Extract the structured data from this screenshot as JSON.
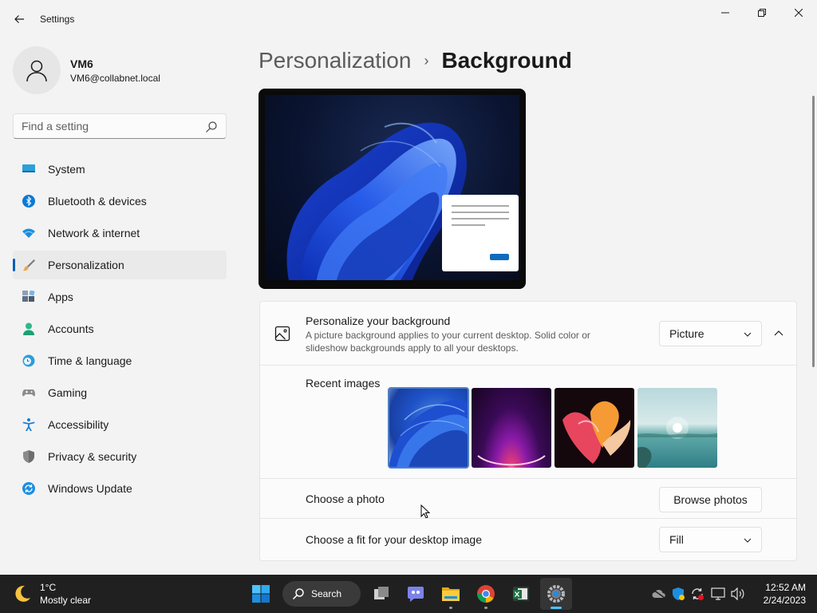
{
  "window": {
    "title": "Settings"
  },
  "profile": {
    "name": "VM6",
    "email": "VM6@collabnet.local"
  },
  "search": {
    "placeholder": "Find a setting"
  },
  "nav": {
    "items": [
      {
        "label": "System",
        "icon": "system-icon"
      },
      {
        "label": "Bluetooth & devices",
        "icon": "bluetooth-icon"
      },
      {
        "label": "Network & internet",
        "icon": "wifi-icon"
      },
      {
        "label": "Personalization",
        "icon": "brush-icon",
        "active": true
      },
      {
        "label": "Apps",
        "icon": "apps-icon"
      },
      {
        "label": "Accounts",
        "icon": "accounts-icon"
      },
      {
        "label": "Time & language",
        "icon": "clock-globe-icon"
      },
      {
        "label": "Gaming",
        "icon": "gamepad-icon"
      },
      {
        "label": "Accessibility",
        "icon": "accessibility-icon"
      },
      {
        "label": "Privacy & security",
        "icon": "shield-icon"
      },
      {
        "label": "Windows Update",
        "icon": "update-icon"
      }
    ]
  },
  "breadcrumb": {
    "parent": "Personalization",
    "separator": "›",
    "current": "Background"
  },
  "background": {
    "title": "Personalize your background",
    "description": "A picture background applies to your current desktop. Solid color or slideshow backgrounds apply to all your desktops.",
    "type_value": "Picture",
    "recent_label": "Recent images",
    "recent_images": [
      {
        "name": "Windows 11 bloom blue",
        "selected": true
      },
      {
        "name": "Purple glow"
      },
      {
        "name": "Colorful ribbon"
      },
      {
        "name": "Lake at sunrise"
      }
    ],
    "choose_photo_label": "Choose a photo",
    "browse_label": "Browse photos",
    "fit_label": "Choose a fit for your desktop image",
    "fit_value": "Fill"
  },
  "taskbar": {
    "weather_temp": "1°C",
    "weather_condition": "Mostly clear",
    "search_label": "Search",
    "apps": [
      "start-icon",
      "search",
      "task-view-icon",
      "teams-chat-icon",
      "file-explorer-icon",
      "chrome-icon",
      "excel-icon",
      "settings-icon"
    ],
    "tray": [
      "onedrive-icon",
      "security-icon",
      "sync-icon",
      "display-icon",
      "volume-icon"
    ],
    "time": "12:52 AM",
    "date": "2/24/2023"
  },
  "colors": {
    "accent": "#005fb8",
    "taskbar": "#202020",
    "background": "#f3f3f3"
  }
}
